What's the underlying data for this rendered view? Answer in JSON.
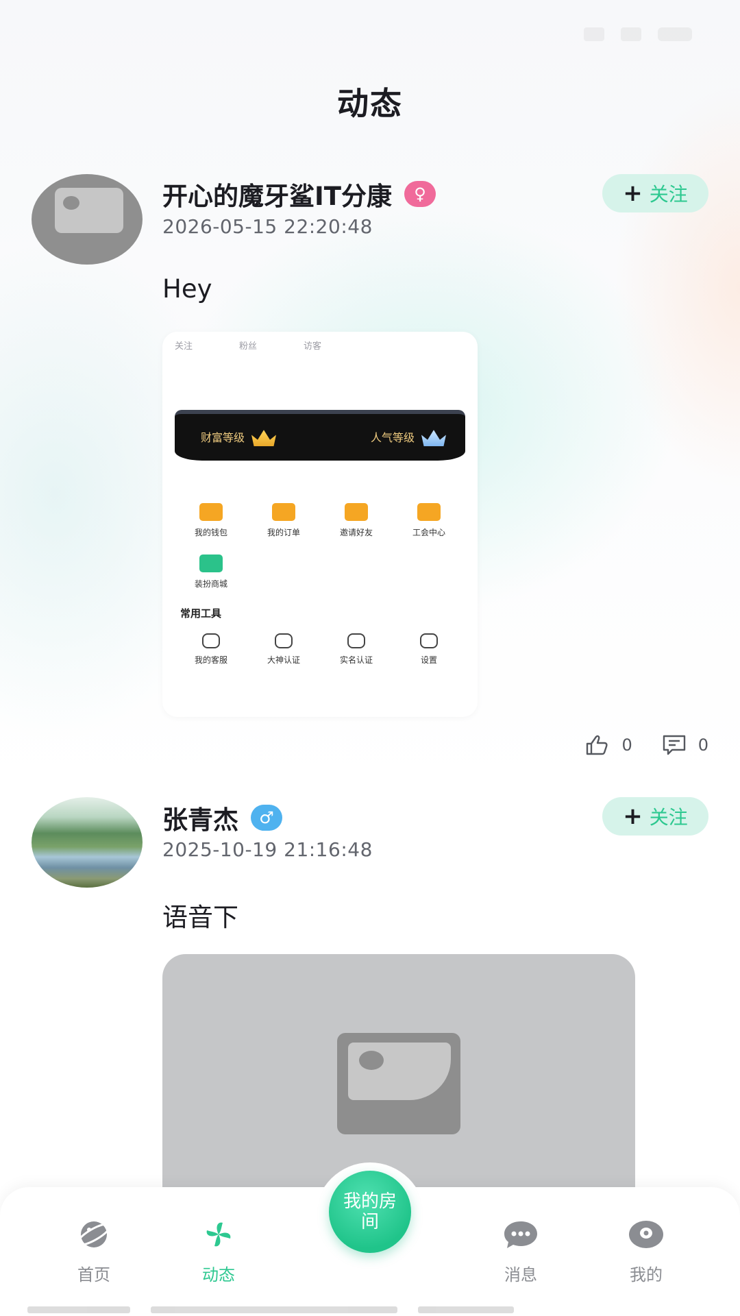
{
  "page": {
    "title": "动态"
  },
  "posts": [
    {
      "name": "开心的魔牙鲨IT分康",
      "gender": "female",
      "gender_symbol": "♀",
      "time": "2026-05-15 22:20:48",
      "follow_label": "关注",
      "text": "Hey",
      "likes": "0",
      "comments": "0",
      "screenshot": {
        "stats": [
          "关注",
          "粉丝",
          "访客"
        ],
        "wealth_level": "财富等级",
        "popularity_level": "人气等级",
        "menu": [
          "我的钱包",
          "我的订单",
          "邀请好友",
          "工会中心",
          "装扮商城"
        ],
        "tools_title": "常用工具",
        "tools": [
          "我的客服",
          "大神认证",
          "实名认证",
          "设置"
        ]
      }
    },
    {
      "name": "张青杰",
      "gender": "male",
      "gender_symbol": "♂",
      "time": "2025-10-19 21:16:48",
      "follow_label": "关注",
      "text": "语音下"
    }
  ],
  "tabs": [
    {
      "label": "首页",
      "icon": "planet-icon",
      "active": false
    },
    {
      "label": "动态",
      "icon": "pinwheel-icon",
      "active": true
    },
    {
      "label": "消息",
      "icon": "chat-bubble-icon",
      "active": false
    },
    {
      "label": "我的",
      "icon": "eye-icon",
      "active": false
    }
  ],
  "center_button": {
    "label": "我的房间"
  },
  "colors": {
    "accent": "#2dc890",
    "female": "#f06a9a",
    "male": "#4fb2ef",
    "follow_bg": "#d6f3ea"
  }
}
